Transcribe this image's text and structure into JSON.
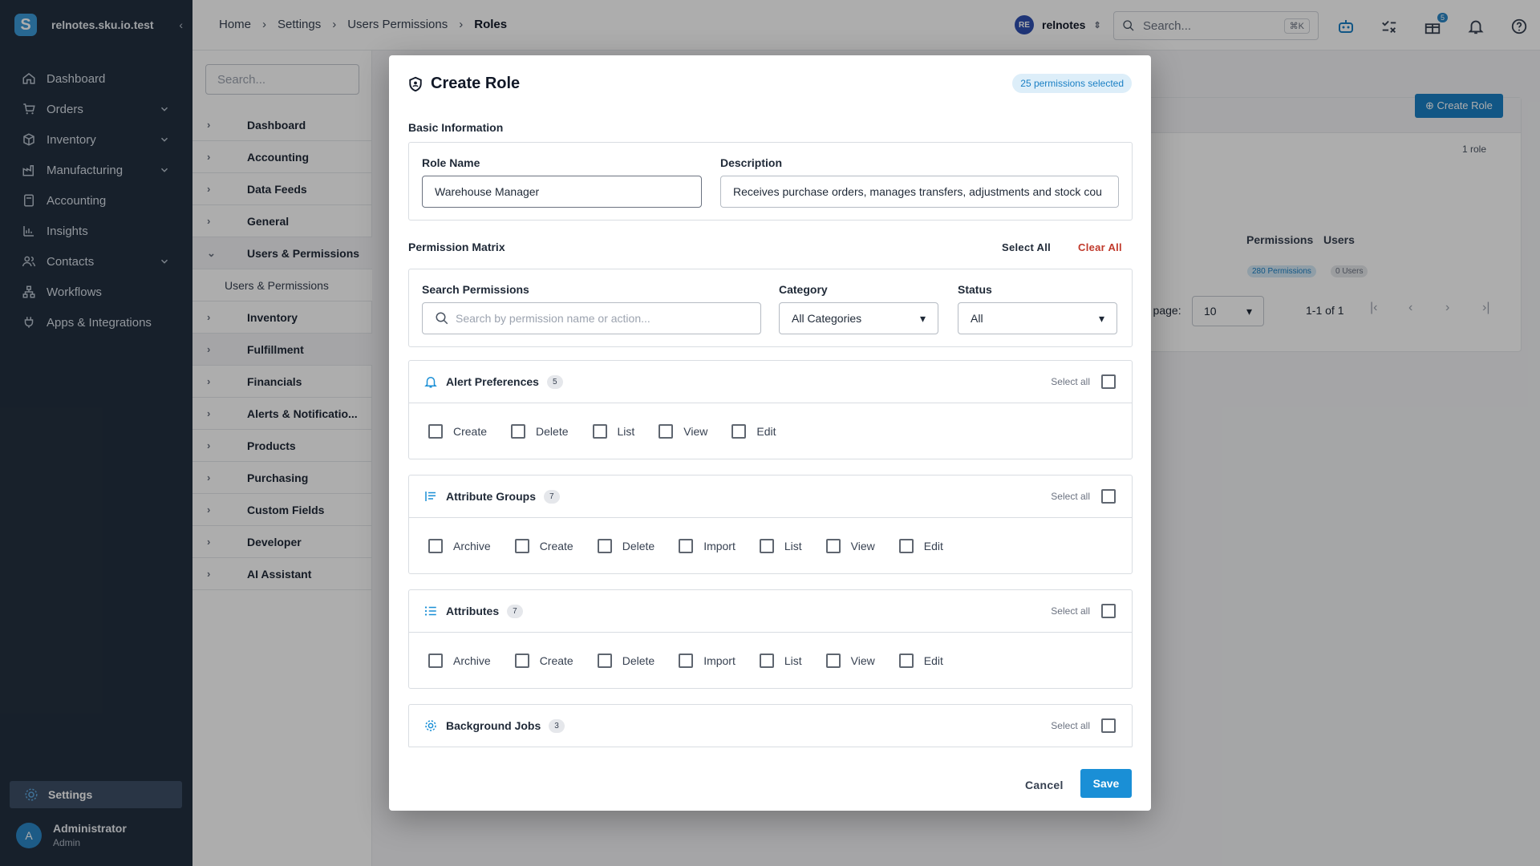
{
  "sidebar": {
    "site_name": "relnotes.sku.io.test",
    "logo_letter": "S",
    "nav": [
      {
        "label": "Dashboard",
        "icon": "home-icon",
        "expandable": false
      },
      {
        "label": "Orders",
        "icon": "cart-icon",
        "expandable": true
      },
      {
        "label": "Inventory",
        "icon": "box-icon",
        "expandable": true
      },
      {
        "label": "Manufacturing",
        "icon": "factory-icon",
        "expandable": true
      },
      {
        "label": "Accounting",
        "icon": "calculator-icon",
        "expandable": false
      },
      {
        "label": "Insights",
        "icon": "chart-icon",
        "expandable": false
      },
      {
        "label": "Contacts",
        "icon": "contacts-icon",
        "expandable": true
      },
      {
        "label": "Workflows",
        "icon": "workflow-icon",
        "expandable": false
      },
      {
        "label": "Apps & Integrations",
        "icon": "plug-icon",
        "expandable": false
      }
    ],
    "settings_label": "Settings",
    "user": {
      "initial": "A",
      "name": "Administrator",
      "role": "Admin"
    }
  },
  "header": {
    "breadcrumbs": [
      "Home",
      "Settings",
      "Users Permissions",
      "Roles"
    ],
    "tenant": {
      "initials": "RE",
      "name": "relnotes"
    },
    "search_placeholder": "Search...",
    "search_shortcut": "⌘K",
    "gift_badge": "5"
  },
  "tree": {
    "search_placeholder": "Search...",
    "items": [
      {
        "label": "Dashboard",
        "expanded": false
      },
      {
        "label": "Accounting",
        "expanded": false
      },
      {
        "label": "Data Feeds",
        "expanded": false
      },
      {
        "label": "General",
        "expanded": false
      },
      {
        "label": "Users & Permissions",
        "expanded": true
      },
      {
        "label": "Users & Permissions",
        "sub": true
      },
      {
        "label": "Inventory",
        "expanded": false
      },
      {
        "label": "Fulfillment",
        "expanded": false
      },
      {
        "label": "Financials",
        "expanded": false
      },
      {
        "label": "Alerts & Notificatio...",
        "expanded": false
      },
      {
        "label": "Products",
        "expanded": false
      },
      {
        "label": "Purchasing",
        "expanded": false
      },
      {
        "label": "Custom Fields",
        "expanded": false
      },
      {
        "label": "Developer",
        "expanded": false
      },
      {
        "label": "AI Assistant",
        "expanded": false
      }
    ]
  },
  "background": {
    "create_role_label": "Create Role",
    "role_count": "1 role",
    "col_permissions": "Permissions",
    "col_users": "Users",
    "permissions_pill": "280 Permissions",
    "users_pill": "0 Users",
    "rows_per_page_label": "r page:",
    "rows_per_page": "10",
    "page_info": "1-1 of 1"
  },
  "modal": {
    "title": "Create Role",
    "selected_badge": "25 permissions selected",
    "basic_info_title": "Basic Information",
    "role_name_label": "Role Name",
    "role_name_value": "Warehouse Manager",
    "description_label": "Description",
    "description_value": "Receives purchase orders, manages transfers, adjustments and stock cou",
    "matrix_title": "Permission Matrix",
    "select_all_label": "Select All",
    "clear_all_label": "Clear All",
    "search_permissions_label": "Search Permissions",
    "search_permissions_placeholder": "Search by permission name or action...",
    "category_label": "Category",
    "category_value": "All Categories",
    "status_label": "Status",
    "status_value": "All",
    "group_select_all": "Select all",
    "groups": [
      {
        "name": "Alert Preferences",
        "count": "5",
        "icon": "bell-icon",
        "perms": [
          "Create",
          "Delete",
          "List",
          "View",
          "Edit"
        ]
      },
      {
        "name": "Attribute Groups",
        "count": "7",
        "icon": "list-lines-icon",
        "perms": [
          "Archive",
          "Create",
          "Delete",
          "Import",
          "List",
          "View",
          "Edit"
        ]
      },
      {
        "name": "Attributes",
        "count": "7",
        "icon": "bulleted-list-icon",
        "perms": [
          "Archive",
          "Create",
          "Delete",
          "Import",
          "List",
          "View",
          "Edit"
        ]
      },
      {
        "name": "Background Jobs",
        "count": "3",
        "icon": "cog-refresh-icon",
        "perms": []
      }
    ],
    "cancel_label": "Cancel",
    "save_label": "Save"
  },
  "colors": {
    "sidebar_bg": "#233040",
    "accent": "#1a8fd6",
    "danger": "#c0392b"
  }
}
